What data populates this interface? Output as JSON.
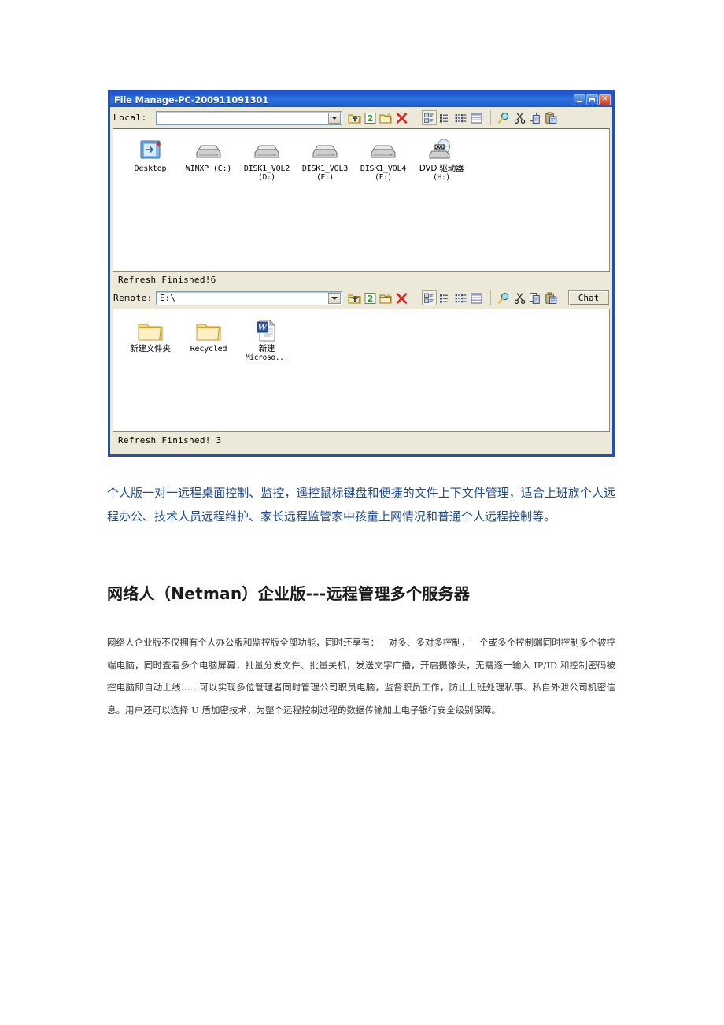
{
  "window": {
    "title": "File Manage-PC-200911091301",
    "sys_buttons": [
      {
        "name": "minimize",
        "glyph": "minimize-icon"
      },
      {
        "name": "maximize",
        "glyph": "maximize-icon"
      },
      {
        "name": "close",
        "glyph": "close-icon",
        "label": "×"
      }
    ],
    "local": {
      "label": "Local:",
      "path_value": "",
      "path_placeholder": "",
      "status": "Refresh Finished!6",
      "items": [
        {
          "name": "Desktop",
          "line2": "",
          "icon": "desktop-icon"
        },
        {
          "name": "WINXP  (C:)",
          "line2": "",
          "icon": "drive-icon"
        },
        {
          "name": "DISK1_VOL2",
          "line2": "(D:)",
          "icon": "drive-icon"
        },
        {
          "name": "DISK1_VOL3",
          "line2": "(E:)",
          "icon": "drive-icon"
        },
        {
          "name": "DISK1_VOL4",
          "line2": "(F:)",
          "icon": "drive-icon"
        },
        {
          "name": "DVD 驱动器",
          "line2": "(H:)",
          "icon": "dvd-drive-icon"
        }
      ]
    },
    "remote": {
      "label": "Remote:",
      "path_value": "E:\\",
      "status": "Refresh Finished! 3",
      "chat_label": "Chat",
      "items": [
        {
          "name": "新建文件夹",
          "line2": "",
          "icon": "folder-icon"
        },
        {
          "name": "Recycled",
          "line2": "",
          "icon": "folder-icon"
        },
        {
          "name": "新建",
          "line2": "Microso...",
          "icon": "word-document-icon"
        }
      ]
    },
    "toolbar": {
      "file_ops": [
        {
          "name": "up-folder-button",
          "icon": "up-folder-icon"
        },
        {
          "name": "refresh-button",
          "icon": "refresh-icon"
        },
        {
          "name": "new-folder-button",
          "icon": "new-folder-icon"
        },
        {
          "name": "delete-button",
          "icon": "delete-x-icon"
        }
      ],
      "view_modes": [
        {
          "name": "view-large-icons-button",
          "icon": "large-icons-icon",
          "selected": true
        },
        {
          "name": "view-small-icons-button",
          "icon": "small-icons-icon",
          "selected": false
        },
        {
          "name": "view-list-button",
          "icon": "list-icon",
          "selected": false
        },
        {
          "name": "view-details-button",
          "icon": "details-icon",
          "selected": false
        }
      ],
      "edit_ops": [
        {
          "name": "search-button",
          "icon": "magnifier-icon"
        },
        {
          "name": "cut-button",
          "icon": "scissors-icon"
        },
        {
          "name": "copy-button",
          "icon": "copy-icon"
        },
        {
          "name": "paste-button",
          "icon": "paste-icon"
        }
      ]
    },
    "colors": {
      "titlebar_blue": "#2468d6",
      "window_border": "#1f4fc4",
      "chrome_face": "#ece9d8",
      "list_background": "#ffffff"
    }
  },
  "document": {
    "lead_paragraph": "个人版一对一远程桌面控制、监控，遥控鼠标键盘和便捷的文件上下文件管理，适合上班族个人远程办公、技术人员远程维护、家长远程监管家中孩童上网情况和普通个人远程控制等。",
    "heading": "网络人（Netman）企业版---远程管理多个服务器",
    "body_paragraph": "网络人企业版不仅拥有个人办公版和监控版全部功能，同时还享有：一对多、多对多控制，一个或多个控制端同时控制多个被控端电脑，同时查看多个电脑屏幕，批量分发文件、批量关机，发送文字广播，开启摄像头，无需逐一输入 IP/ID 和控制密码被控电脑即自动上线……可以实现多位管理者同时管理公司职员电脑，监督职员工作，防止上班处理私事、私自外泄公司机密信息。用户还可以选择 U 盾加密技术，为整个远程控制过程的数据传输加上电子银行安全级别保障。"
  }
}
